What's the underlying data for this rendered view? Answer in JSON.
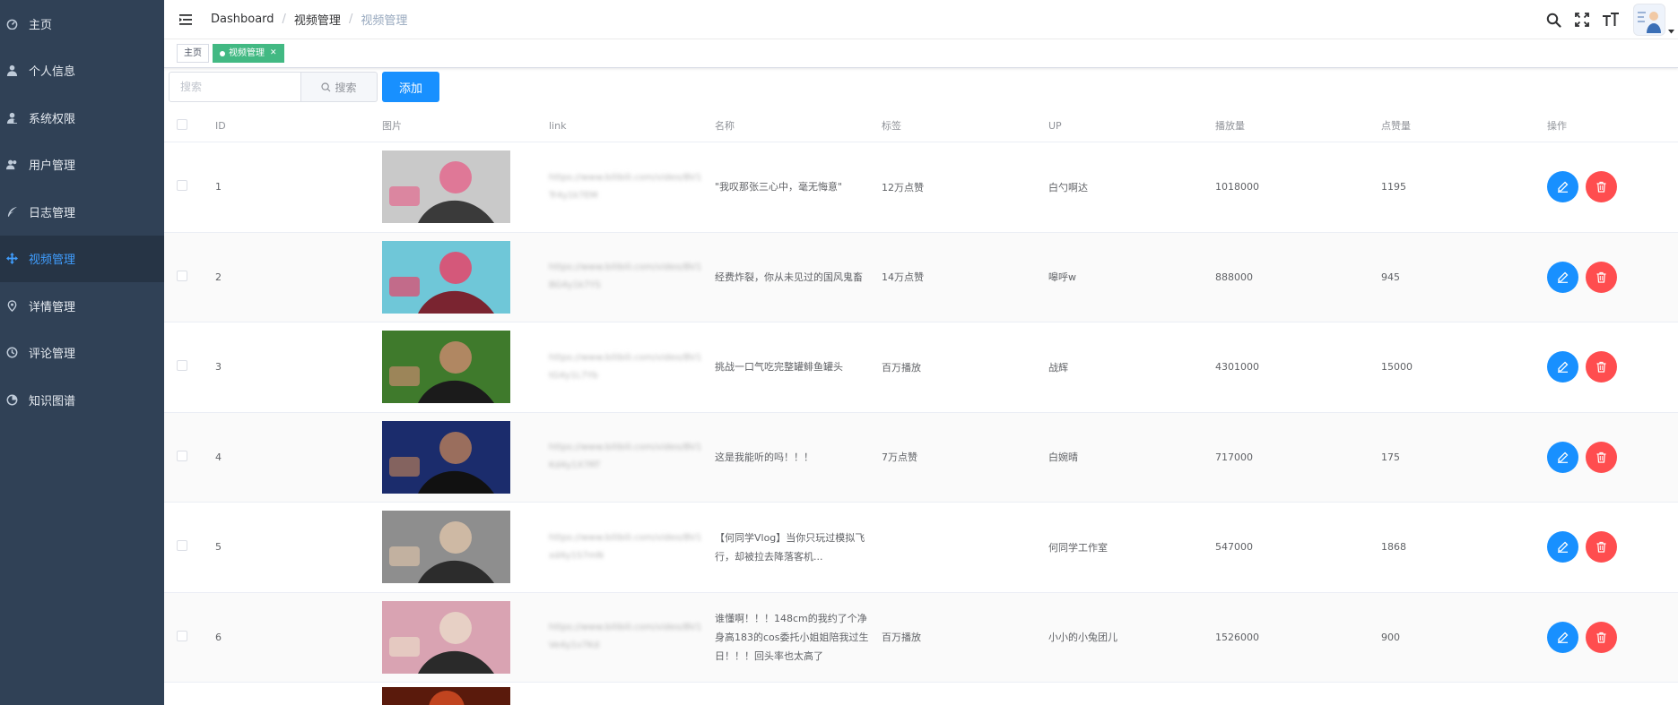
{
  "sidebar": {
    "items": [
      {
        "label": "主页",
        "icon": "dashboard-icon",
        "active": false
      },
      {
        "label": "个人信息",
        "icon": "user-icon",
        "active": false
      },
      {
        "label": "系统权限",
        "icon": "permission-icon",
        "active": false
      },
      {
        "label": "用户管理",
        "icon": "peoples-icon",
        "active": false
      },
      {
        "label": "日志管理",
        "icon": "feather-icon",
        "active": false
      },
      {
        "label": "视频管理",
        "icon": "move-icon",
        "active": true
      },
      {
        "label": "详情管理",
        "icon": "location-icon",
        "active": false
      },
      {
        "label": "评论管理",
        "icon": "time-icon",
        "active": false
      },
      {
        "label": "知识图谱",
        "icon": "chart-icon",
        "active": false
      }
    ]
  },
  "navbar": {
    "breadcrumb": [
      "Dashboard",
      "视频管理",
      "视频管理"
    ]
  },
  "tags": {
    "home": "主页",
    "active": "视频管理"
  },
  "toolbar": {
    "search_placeholder": "搜索",
    "search_button": "搜索",
    "add_button": "添加"
  },
  "table": {
    "headers": {
      "id": "ID",
      "image": "图片",
      "link": "link",
      "name": "名称",
      "tag": "标签",
      "up": "UP",
      "plays": "播放量",
      "likes": "点赞量",
      "actions": "操作"
    },
    "rows": [
      {
        "id": "1",
        "link": "https://www.bilibili.com/video/BV1Tr4y1k7EM",
        "name": "\"我叹那张三心中，毫无悔意\"",
        "tag": "12万点赞",
        "up": "白勺啊达",
        "plays": "1018000",
        "likes": "1195",
        "thumb_colors": [
          "#c9c9c9",
          "#3a3a3a",
          "#e36a8e"
        ]
      },
      {
        "id": "2",
        "link": "https://www.bilibili.com/video/BV1BG4y1k7YS",
        "name": "经费炸裂，你从未见过的国风鬼畜",
        "tag": "14万点赞",
        "up": "嗥呼w",
        "plays": "888000",
        "likes": "945",
        "thumb_colors": [
          "#6fc7d8",
          "#7a2430",
          "#e6446a"
        ]
      },
      {
        "id": "3",
        "link": "https://www.bilibili.com/video/BV1tG4y1L7Yb",
        "name": "挑战一口气吃完整罐鲱鱼罐头",
        "tag": "百万播放",
        "up": "战辉",
        "plays": "4301000",
        "likes": "15000",
        "thumb_colors": [
          "#3f7a2c",
          "#1b1b1b",
          "#c48a6c"
        ]
      },
      {
        "id": "4",
        "link": "https://www.bilibili.com/video/BV1Kd4y1X7RT",
        "name": "这是我能听的吗！！！",
        "tag": "7万点赞",
        "up": "白婉晴",
        "plays": "717000",
        "likes": "175",
        "thumb_colors": [
          "#1b2c6c",
          "#111111",
          "#b07a5a"
        ]
      },
      {
        "id": "5",
        "link": "https://www.bilibili.com/video/BV1xd4y1S7mN",
        "name": "【何同学Vlog】当你只玩过模拟飞行，却被拉去降落客机...",
        "tag": "",
        "up": "何同学工作室",
        "plays": "547000",
        "likes": "1868",
        "thumb_colors": [
          "#8e8e8e",
          "#2c2c2c",
          "#d9c1a8"
        ]
      },
      {
        "id": "6",
        "link": "https://www.bilibili.com/video/BV1Ve4y1v7Kd",
        "name": "谁懂啊！！！148cm的我约了个净身高183的cos委托小姐姐陪我过生日！！！回头率也太高了",
        "tag": "百万播放",
        "up": "小小的小兔团儿",
        "plays": "1526000",
        "likes": "900",
        "thumb_colors": [
          "#d9a3b2",
          "#2a2a2a",
          "#e9d8c8"
        ]
      }
    ],
    "partial_thumb_colors": [
      "#c1441f",
      "#5a1a0c"
    ]
  }
}
